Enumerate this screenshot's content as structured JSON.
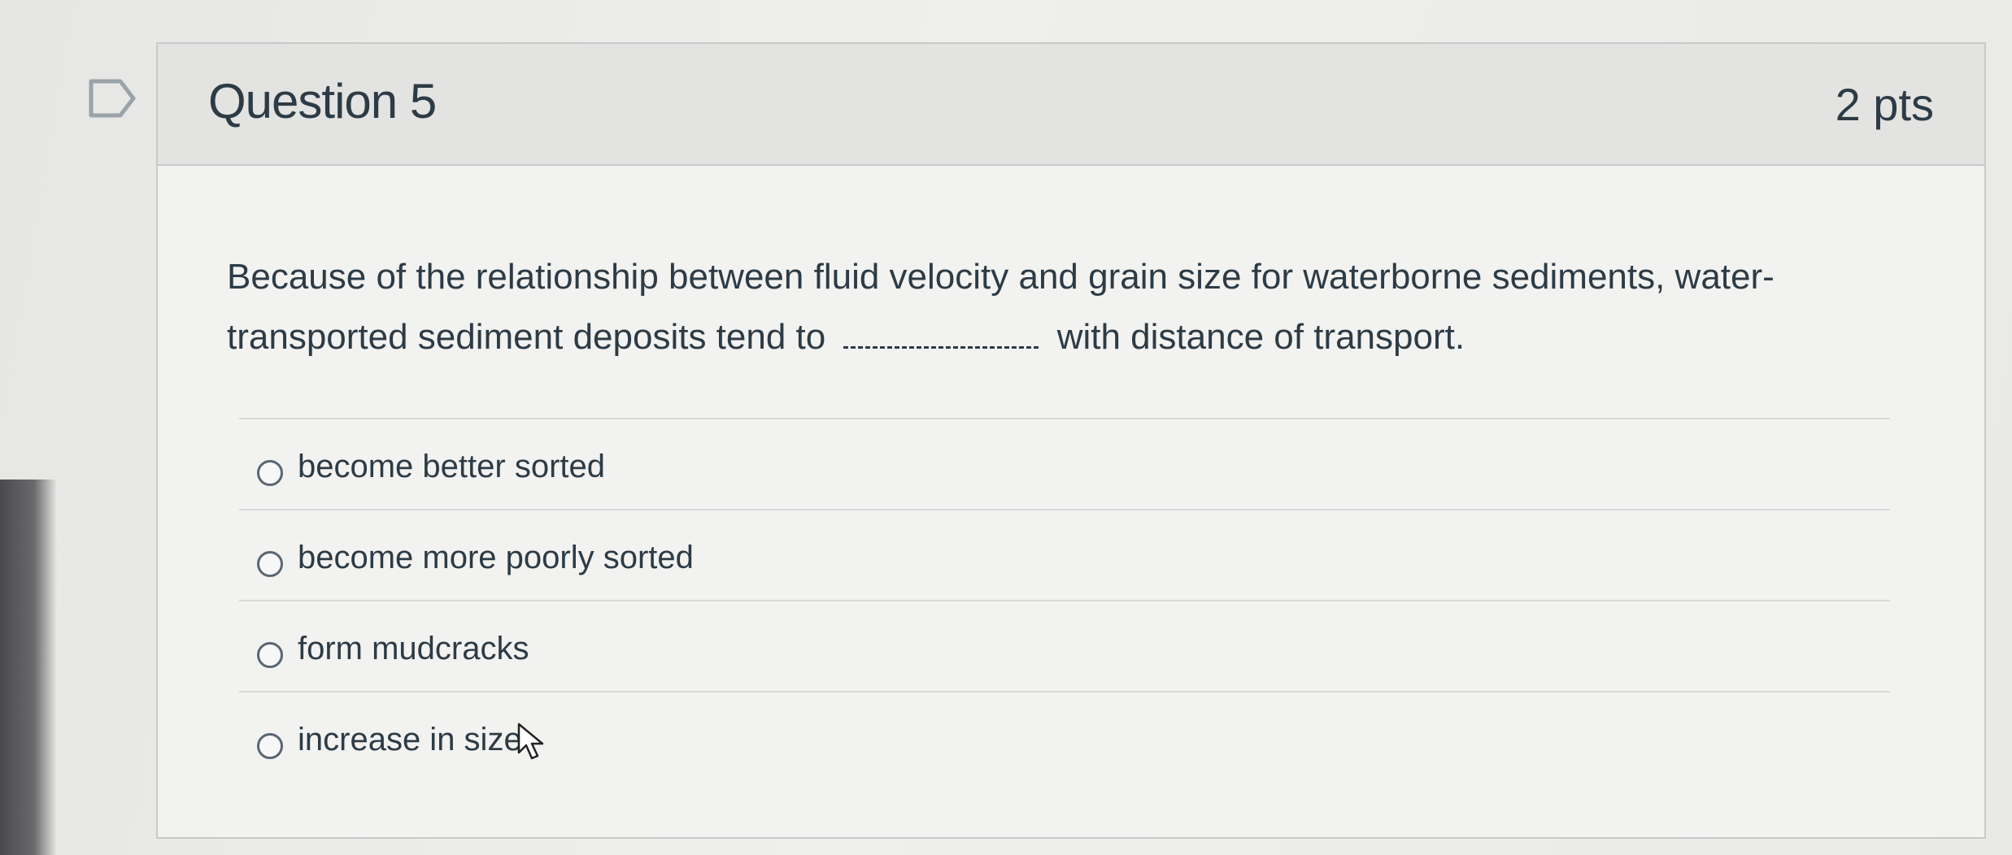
{
  "question": {
    "title": "Question 5",
    "points": "2 pts",
    "text_before_blank": "Because of the relationship between fluid velocity and grain size for waterborne sediments, water-transported sediment deposits tend to",
    "text_after_blank": "with distance of transport."
  },
  "answers": [
    {
      "label": "become better sorted",
      "selected": false
    },
    {
      "label": "become more poorly sorted",
      "selected": false
    },
    {
      "label": "form mudcracks",
      "selected": false
    },
    {
      "label": "increase in size",
      "selected": false
    }
  ],
  "icons": {
    "flag": "flag-icon",
    "cursor": "mouse-pointer-icon",
    "radio": "radio-button-icon"
  },
  "colors": {
    "text": "#2d3b45",
    "header_bg": "#e3e3e2",
    "card_bg": "#f2f2f1",
    "border": "#c9c9c9"
  }
}
